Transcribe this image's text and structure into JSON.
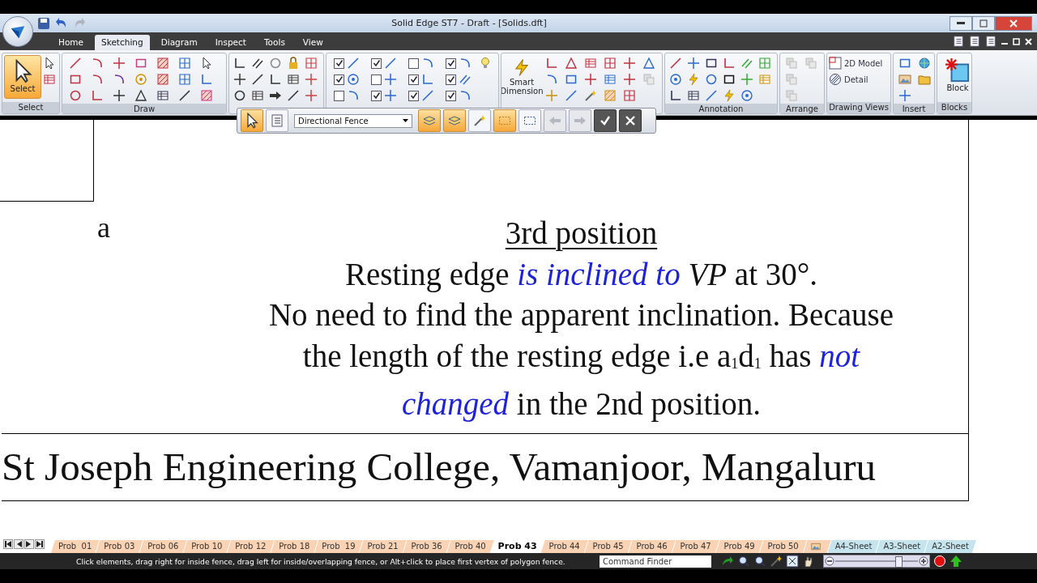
{
  "window": {
    "title": "Solid Edge ST7 - Draft - [Solids.dft]"
  },
  "ribbon_tabs": [
    {
      "label": "Home",
      "selected": false
    },
    {
      "label": "Sketching",
      "selected": true
    },
    {
      "label": "Diagram",
      "selected": false
    },
    {
      "label": "Inspect",
      "selected": false
    },
    {
      "label": "Tools",
      "selected": false
    },
    {
      "label": "View",
      "selected": false
    }
  ],
  "ribbon_groups": [
    {
      "kind": "select",
      "label": "Select",
      "button": "Select"
    },
    {
      "kind": "draw",
      "label": "Draw"
    },
    {
      "kind": "relate"
    },
    {
      "kind": "relations",
      "checkboxes": [
        {
          "checked": true
        },
        {
          "checked": true
        },
        {
          "checked": false
        },
        {
          "checked": true
        },
        {
          "checked": false
        },
        {
          "checked": true
        },
        {
          "checked": false
        },
        {
          "checked": true
        },
        {
          "checked": true
        },
        {
          "checked": true
        },
        {
          "checked": true
        },
        {
          "checked": true
        }
      ]
    },
    {
      "kind": "dimension",
      "button": "Smart Dimension"
    },
    {
      "kind": "annotation",
      "label": "Annotation"
    },
    {
      "kind": "arrange",
      "label": "Arrange"
    },
    {
      "kind": "views",
      "label": "Drawing Views",
      "buttons": [
        "2D Model",
        "Detail"
      ]
    },
    {
      "kind": "insert",
      "label": "Insert"
    },
    {
      "kind": "block",
      "label": "Blocks",
      "button": "Block"
    }
  ],
  "fence_toolbar": {
    "dropdown": "Directional Fence",
    "toggles": [
      {
        "kind": "select",
        "on": true
      },
      {
        "kind": "options",
        "on": false
      },
      {
        "kind": "inside",
        "on": true
      },
      {
        "kind": "overlap",
        "on": true
      },
      {
        "kind": "power",
        "on": false
      },
      {
        "kind": "rect",
        "on": true
      },
      {
        "kind": "poly",
        "on": false
      }
    ],
    "steps": [
      {
        "kind": "back",
        "disabled": true
      },
      {
        "kind": "forward",
        "disabled": true
      }
    ],
    "actions": [
      {
        "kind": "accept"
      },
      {
        "kind": "cancel"
      }
    ]
  },
  "drawing": {
    "corner_label": "a",
    "title": "3rd position",
    "statement": [
      [
        {
          "text": "Resting edge ",
          "kind": "plain"
        },
        {
          "text": "is inclined to",
          "kind": "emphasis"
        },
        {
          "text": " VP",
          "kind": "term"
        },
        {
          "text": " at 30°.",
          "kind": "plain"
        }
      ]
    ],
    "explanation": [
      [
        {
          "text": "No need to find the apparent inclination. Because",
          "kind": "plain"
        }
      ],
      [
        {
          "text": "the length of the resting edge i.e a$_{1}$d$_{1}$ has ",
          "kind": "plain"
        },
        {
          "text": "not",
          "kind": "emphasis"
        }
      ],
      [
        {
          "text": "changed",
          "kind": "emphasis"
        },
        {
          "text": " in the 2nd position.",
          "kind": "plain"
        }
      ]
    ],
    "footer": "St Joseph Engineering College, Vamanjoor, Mangaluru"
  },
  "sheet_tabs": [
    {
      "kind": "problem",
      "label": "Prob  01",
      "selected": false
    },
    {
      "kind": "problem",
      "label": "Prob 03",
      "selected": false
    },
    {
      "kind": "problem",
      "label": "Prob 06",
      "selected": false
    },
    {
      "kind": "problem",
      "label": "Prob 10",
      "selected": false
    },
    {
      "kind": "problem",
      "label": "Prob 12",
      "selected": false
    },
    {
      "kind": "problem",
      "label": "Prob 18",
      "selected": false
    },
    {
      "kind": "problem",
      "label": "Prob  19",
      "selected": false
    },
    {
      "kind": "problem",
      "label": "Prob 21",
      "selected": false
    },
    {
      "kind": "problem",
      "label": "Prob 36",
      "selected": false
    },
    {
      "kind": "problem",
      "label": "Prob 40",
      "selected": false
    },
    {
      "kind": "problem",
      "label": "Prob 43",
      "selected": true
    },
    {
      "kind": "problem",
      "label": "Prob 44",
      "selected": false
    },
    {
      "kind": "problem",
      "label": "Prob 45",
      "selected": false
    },
    {
      "kind": "problem",
      "label": "Prob 46",
      "selected": false
    },
    {
      "kind": "problem",
      "label": "Prob 47",
      "selected": false
    },
    {
      "kind": "problem",
      "label": "Prob 49",
      "selected": false
    },
    {
      "kind": "problem",
      "label": "Prob 50",
      "selected": false
    },
    {
      "kind": "icon",
      "selected": false
    },
    {
      "kind": "sheet",
      "label": "A4-Sheet",
      "selected": false
    },
    {
      "kind": "sheet",
      "label": "A3-Sheet",
      "selected": false
    },
    {
      "kind": "sheet",
      "label": "A2-Sheet",
      "selected": false
    }
  ],
  "status_bar": {
    "message": "Click elements, drag right for inside fence, drag left for inside/overlapping fence, or Alt+click to place first vertex of polygon fence.",
    "command_finder": {
      "placeholder": "Command Finder"
    },
    "zoom": {
      "level": 0.76
    }
  }
}
